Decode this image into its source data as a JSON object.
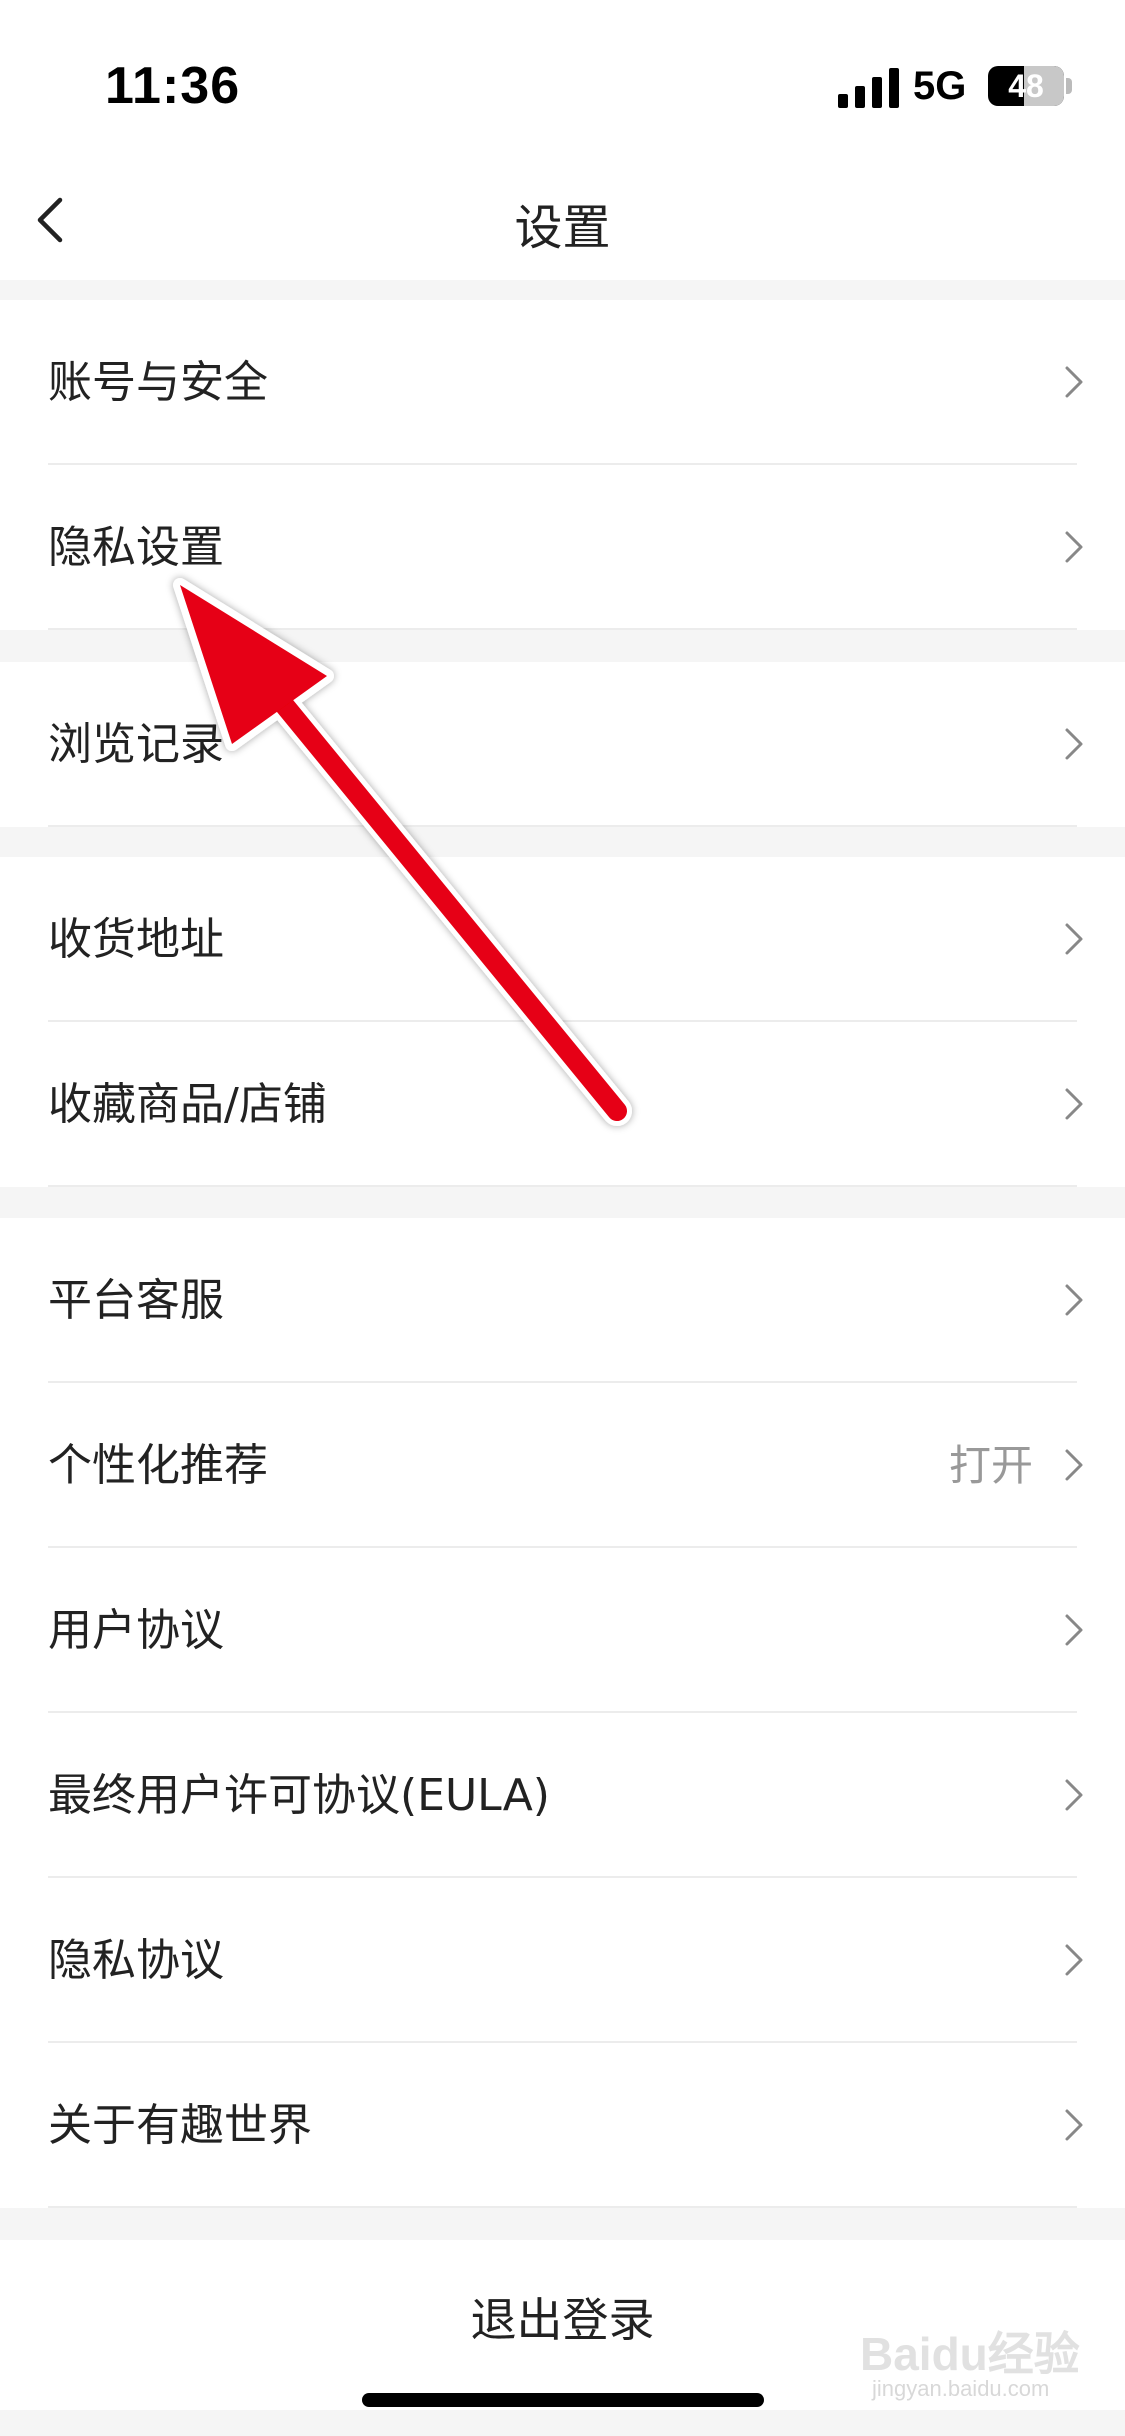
{
  "status_bar": {
    "time": "11:36",
    "network": "5G",
    "battery": "48",
    "battery_level": 0.48
  },
  "nav": {
    "title": "设置"
  },
  "groups": [
    {
      "items": [
        {
          "label": "账号与安全"
        },
        {
          "label": "隐私设置"
        }
      ]
    },
    {
      "items": [
        {
          "label": "浏览记录"
        }
      ]
    },
    {
      "items": [
        {
          "label": "收货地址"
        },
        {
          "label": "收藏商品/店铺"
        }
      ]
    },
    {
      "items": [
        {
          "label": "平台客服"
        },
        {
          "label": "个性化推荐",
          "value": "打开"
        },
        {
          "label": "用户协议"
        },
        {
          "label": "最终用户许可协议(EULA)"
        },
        {
          "label": "隐私协议"
        },
        {
          "label": "关于有趣世界"
        }
      ]
    }
  ],
  "logout": {
    "label": "退出登录"
  },
  "watermark": {
    "brand": "Baidu经验",
    "url": "jingyan.baidu.com"
  },
  "colors": {
    "annotation_arrow": "#e60012",
    "page_background": "#f5f5f5"
  }
}
